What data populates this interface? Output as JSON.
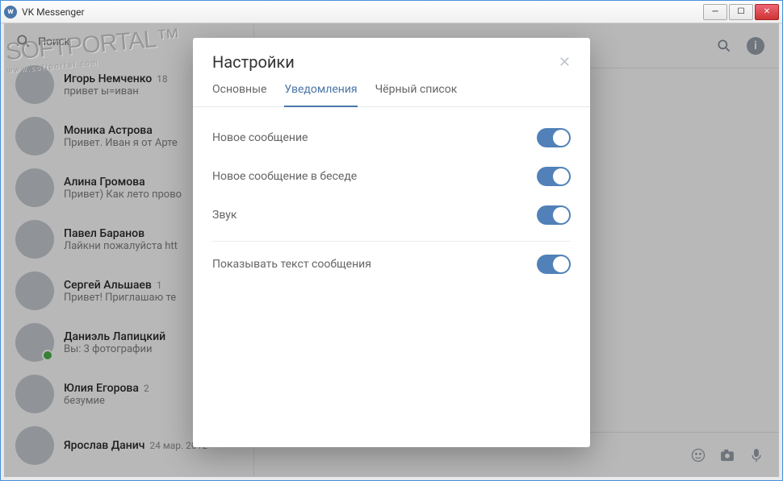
{
  "window": {
    "title": "VK Messenger"
  },
  "search": {
    "placeholder": "Поиск"
  },
  "chats": [
    {
      "name": "Игорь Немченко",
      "time": "18",
      "preview": "привет ы=иван",
      "online": false
    },
    {
      "name": "Моника Астрова",
      "time": "",
      "preview": "Привет. Иван я от Арте",
      "online": false
    },
    {
      "name": "Алина Громова",
      "time": "",
      "preview": "Привет) Как лето прово",
      "online": false
    },
    {
      "name": "Павел Баранов",
      "time": "",
      "preview": "Лайкни пожалуйста htt",
      "online": false
    },
    {
      "name": "Сергей Альшаев",
      "time": "1",
      "preview": "Привет! Приглашаю те",
      "online": false
    },
    {
      "name": "Даниэль Лапицкий",
      "time": "",
      "preview": "Вы: 3 фотографии",
      "online": true
    },
    {
      "name": "Юлия Егорова",
      "time": "2",
      "preview": "безумие",
      "online": false
    },
    {
      "name": "Ярослав Данич",
      "time": "24 мар. 2012",
      "preview": "",
      "online": false
    }
  ],
  "modal": {
    "title": "Настройки",
    "tabs": [
      {
        "label": "Основные",
        "active": false
      },
      {
        "label": "Уведомления",
        "active": true
      },
      {
        "label": "Чёрный список",
        "active": false
      }
    ],
    "settings": [
      {
        "label": "Новое сообщение",
        "on": true
      },
      {
        "label": "Новое сообщение в беседе",
        "on": true
      },
      {
        "label": "Звук",
        "on": true
      }
    ],
    "extra": {
      "label": "Показывать текст сообщения",
      "on": true
    }
  },
  "watermark": {
    "line1": "SOFTPORTAL",
    "line2": "www.softportal.com"
  }
}
